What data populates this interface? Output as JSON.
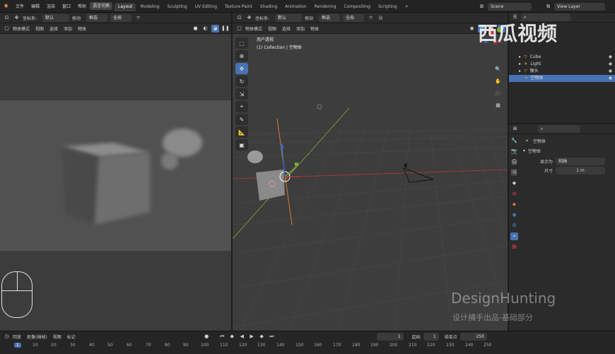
{
  "menu": [
    "文件",
    "编辑",
    "渲染",
    "窗口",
    "帮助"
  ],
  "workspace_switch_label": "语言切换",
  "workspaces": [
    "Layout",
    "Modeling",
    "Sculpting",
    "UV Editing",
    "Texture Paint",
    "Shading",
    "Animation",
    "Rendering",
    "Compositing",
    "Scripting"
  ],
  "active_workspace": "Layout",
  "scene_name": "Scene",
  "view_layer": "View Layer",
  "left_header": {
    "coord_label": "坐标系:",
    "coord_value": "默认",
    "drag_label": "拖动",
    "select_value": "框选",
    "global_value": "全局",
    "mode": "物体模式",
    "menus": [
      "视图",
      "选择",
      "添加",
      "物体"
    ]
  },
  "main_header": {
    "coord_label": "坐标系:",
    "coord_value": "默认",
    "drag_label": "拖动",
    "select_value": "框选",
    "global_value": "全局",
    "mode": "物体模式",
    "menus": [
      "视图",
      "选择",
      "添加",
      "物体"
    ]
  },
  "viewport_info": {
    "line1": "用户透视",
    "line2": "(1) Collection | 空物体"
  },
  "outliner": {
    "items": [
      {
        "name": "Cube",
        "icon_color": "#e8a04a"
      },
      {
        "name": "Light",
        "icon_color": "#e8a04a"
      },
      {
        "name": "猴头",
        "icon_color": "#e8a04a"
      },
      {
        "name": "空物体",
        "icon_color": "#e8a04a",
        "selected": true
      }
    ]
  },
  "properties": {
    "object_name": "空物体",
    "section": "空物体",
    "display_as_label": "显示为",
    "display_as_value": "纯轴",
    "size_label": "尺寸",
    "size_value": "1 m"
  },
  "timeline": {
    "playback": "回放",
    "keying": "抠像(插帧)",
    "view": "视图",
    "marker": "标记",
    "current_frame": "1",
    "start_label": "起始",
    "start_value": "1",
    "end_label": "结束点",
    "end_value": "250",
    "ruler": [
      "1",
      "10",
      "20",
      "30",
      "40",
      "50",
      "60",
      "70",
      "80",
      "90",
      "100",
      "110",
      "120",
      "130",
      "140",
      "150",
      "160",
      "170",
      "180",
      "190",
      "200",
      "210",
      "220",
      "230",
      "240",
      "250"
    ]
  },
  "watermark": {
    "brand": "西瓜视频",
    "line1": "DesignHunting",
    "line2": "设计捕手出品-基础部分"
  },
  "colors": {
    "accent": "#4772b3",
    "x_axis": "#c0393b",
    "y_axis": "#7fae3a",
    "z_axis": "#3a66c4",
    "origin": "#e8a04a"
  }
}
